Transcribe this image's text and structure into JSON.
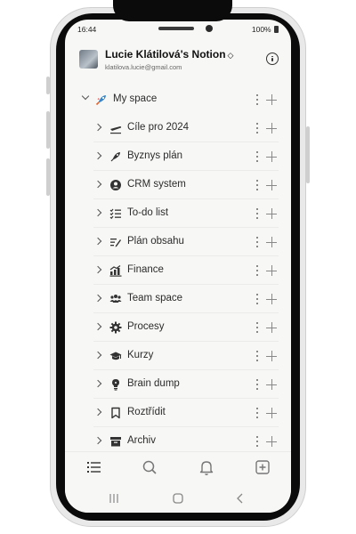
{
  "status": {
    "time": "16:44",
    "battery": "100%"
  },
  "workspace": {
    "name": "Lucie Klátilová's Notion",
    "switch_glyph": "◇",
    "email": "klatilova.lucie@gmail.com"
  },
  "sidebar": {
    "section": {
      "label": "My space",
      "icon": "rocket-icon",
      "expanded": true
    },
    "items": [
      {
        "label": "Cíle pro 2024",
        "icon": "airplane-icon"
      },
      {
        "label": "Byznys plán",
        "icon": "rocket-icon"
      },
      {
        "label": "CRM system",
        "icon": "user-circle-icon"
      },
      {
        "label": "To-do list",
        "icon": "checklist-icon"
      },
      {
        "label": "Plán obsahu",
        "icon": "edit-list-icon"
      },
      {
        "label": "Finance",
        "icon": "chart-icon"
      },
      {
        "label": "Team space",
        "icon": "team-icon"
      },
      {
        "label": "Procesy",
        "icon": "gear-icon"
      },
      {
        "label": "Kurzy",
        "icon": "graduation-cap-icon"
      },
      {
        "label": "Brain dump",
        "icon": "lightbulb-icon"
      },
      {
        "label": "Roztřídit",
        "icon": "bookmark-icon"
      },
      {
        "label": "Archiv",
        "icon": "archive-icon"
      }
    ]
  },
  "tabbar": {
    "items": [
      "list-icon",
      "search-icon",
      "bell-icon",
      "new-page-icon"
    ]
  },
  "navbar": {
    "items": [
      "recent-apps-icon",
      "home-icon",
      "back-icon"
    ]
  }
}
